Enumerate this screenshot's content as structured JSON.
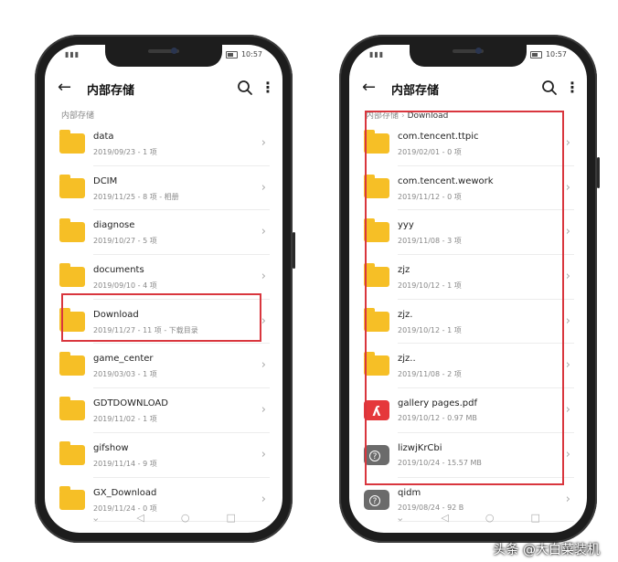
{
  "status": {
    "time": "10:57"
  },
  "left": {
    "title": "内部存储",
    "breadcrumb": "内部存储",
    "items": [
      {
        "name": "data",
        "meta": "2019/09/23 - 1 项",
        "type": "folder"
      },
      {
        "name": "DCIM",
        "meta": "2019/11/25 - 8 项 - 相册",
        "type": "folder"
      },
      {
        "name": "diagnose",
        "meta": "2019/10/27 - 5 项",
        "type": "folder"
      },
      {
        "name": "documents",
        "meta": "2019/09/10 - 4 项",
        "type": "folder"
      },
      {
        "name": "Download",
        "meta": "2019/11/27 - 11 项 - 下载目录",
        "type": "folder"
      },
      {
        "name": "game_center",
        "meta": "2019/03/03 - 1 项",
        "type": "folder"
      },
      {
        "name": "GDTDOWNLOAD",
        "meta": "2019/11/02 - 1 项",
        "type": "folder"
      },
      {
        "name": "gifshow",
        "meta": "2019/11/14 - 9 项",
        "type": "folder"
      },
      {
        "name": "GX_Download",
        "meta": "2019/11/24 - 0 项",
        "type": "folder"
      }
    ]
  },
  "right": {
    "title": "内部存储",
    "breadcrumb": {
      "root": "内部存储",
      "current": "Download"
    },
    "items": [
      {
        "name": "com.tencent.ttpic",
        "meta": "2019/02/01 - 0 项",
        "type": "folder"
      },
      {
        "name": "com.tencent.wework",
        "meta": "2019/11/12 - 0 项",
        "type": "folder"
      },
      {
        "name": "yyy",
        "meta": "2019/11/08 - 3 项",
        "type": "folder"
      },
      {
        "name": "zjz",
        "meta": "2019/10/12 - 1 项",
        "type": "folder"
      },
      {
        "name": "zjz.",
        "meta": "2019/10/12 - 1 项",
        "type": "folder"
      },
      {
        "name": "zjz..",
        "meta": "2019/11/08 - 2 项",
        "type": "folder"
      },
      {
        "name": "gallery pages.pdf",
        "meta": "2019/10/12 - 0.97 MB",
        "type": "pdf"
      },
      {
        "name": "lizwjKrCbi",
        "meta": "2019/10/24 - 15.57 MB",
        "type": "unknown"
      },
      {
        "name": "qidm",
        "meta": "2019/08/24 - 92 B",
        "type": "unknown"
      }
    ]
  },
  "colors": {
    "accent_highlight": "#d9363e",
    "folder": "#f6bf26",
    "pdf": "#e5383b"
  },
  "watermark": "头条 @大白菜装机"
}
